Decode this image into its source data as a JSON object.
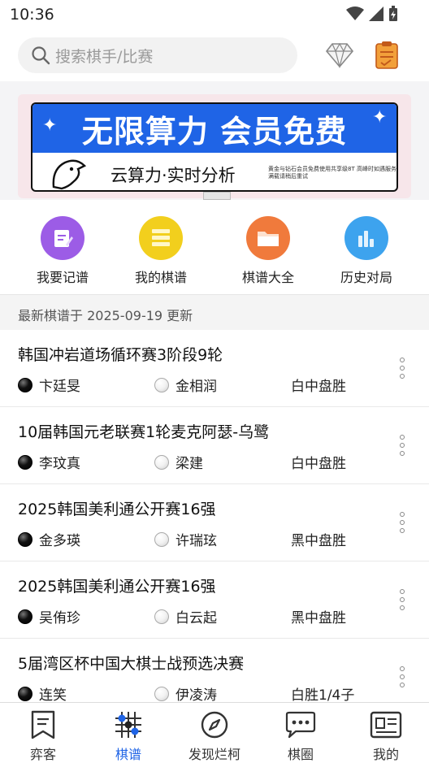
{
  "status_bar": {
    "time": "10:36"
  },
  "search": {
    "placeholder": "搜索棋手/比赛"
  },
  "banner": {
    "title": "无限算力 会员免费",
    "subtitle": "云算力·实时分析",
    "note": "黄金与钻石会员免费使用共享级8T 高峰时如遇服务满载请稍后重试"
  },
  "quick_nav": [
    {
      "label": "我要记谱",
      "color": "#9c5ce6",
      "icon": "edit-icon"
    },
    {
      "label": "我的棋谱",
      "color": "#f2cf1d",
      "icon": "list-icon"
    },
    {
      "label": "棋谱大全",
      "color": "#f07a3c",
      "icon": "folder-icon"
    },
    {
      "label": "历史对局",
      "color": "#3da3ee",
      "icon": "chart-icon"
    }
  ],
  "update_text": "最新棋谱于 2025-09-19 更新",
  "games": [
    {
      "title": "韩国冲岩道场循环赛3阶段9轮",
      "black": "卞廷旻",
      "white": "金相润",
      "result": "白中盘胜"
    },
    {
      "title": "10届韩国元老联赛1轮麦克阿瑟-乌鹭",
      "black": "李玟真",
      "white": "梁建",
      "result": "白中盘胜"
    },
    {
      "title": "2025韩国美利通公开赛16强",
      "black": "金多瑛",
      "white": "许瑞玹",
      "result": "黑中盘胜"
    },
    {
      "title": "2025韩国美利通公开赛16强",
      "black": "吴侑珍",
      "white": "白云起",
      "result": "黑中盘胜"
    },
    {
      "title": "5届湾区杯中国大棋士战预选决赛",
      "black": "连笑",
      "white": "伊凌涛",
      "result": "白胜1/4子"
    }
  ],
  "bottom_nav": [
    {
      "label": "弈客",
      "icon": "bookmark-icon",
      "active": false
    },
    {
      "label": "棋谱",
      "icon": "board-icon",
      "active": true
    },
    {
      "label": "发现烂柯",
      "icon": "compass-icon",
      "active": false
    },
    {
      "label": "棋圈",
      "icon": "chat-icon",
      "active": false
    },
    {
      "label": "我的",
      "icon": "profile-card-icon",
      "active": false
    }
  ],
  "colors": {
    "accent": "#1f64e6",
    "banner_blue": "#1f64e6"
  }
}
